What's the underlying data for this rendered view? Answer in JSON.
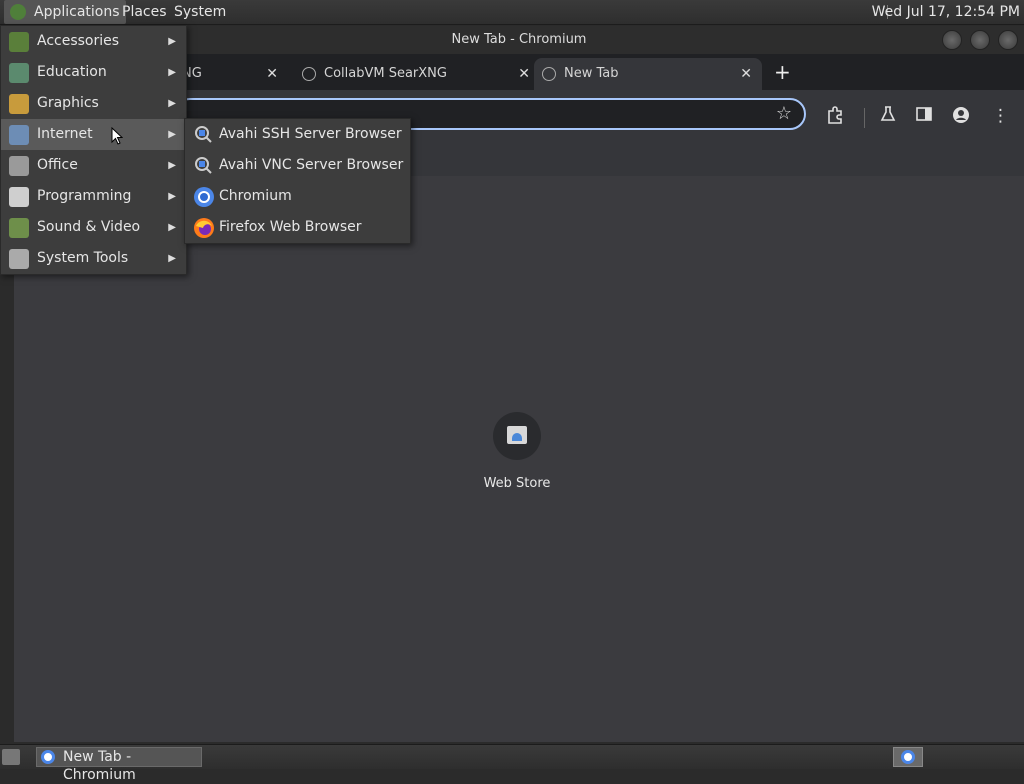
{
  "top_panel": {
    "applications": "Applications",
    "places": "Places",
    "system": "System",
    "clock": "Wed Jul 17, 12:54 PM"
  },
  "window": {
    "title": "New Tab - Chromium"
  },
  "tabs": [
    {
      "title": "NG",
      "close": "✕"
    },
    {
      "title": "CollabVM SearXNG",
      "close": "✕"
    },
    {
      "title": "New Tab",
      "close": "✕"
    }
  ],
  "new_tab": "+",
  "icons": {
    "star": "☆",
    "extensions": "puzzle-icon",
    "labs": "flask-icon",
    "side_panel": "side-panel-icon",
    "profile": "profile-icon",
    "more": "⋮"
  },
  "content": {
    "shortcut_label": "Web Store"
  },
  "apps_menu": {
    "items": [
      {
        "label": "Accessories",
        "icon": "accessories-icon",
        "color": "#5a7f3a"
      },
      {
        "label": "Education",
        "icon": "education-icon",
        "color": "#5b8a6e"
      },
      {
        "label": "Graphics",
        "icon": "graphics-icon",
        "color": "#c89b3c"
      },
      {
        "label": "Internet",
        "icon": "internet-icon",
        "color": "#6d8db5"
      },
      {
        "label": "Office",
        "icon": "office-icon",
        "color": "#9a9a9a"
      },
      {
        "label": "Programming",
        "icon": "programming-icon",
        "color": "#cfcfcf"
      },
      {
        "label": "Sound & Video",
        "icon": "sound-video-icon",
        "color": "#6e8f4a"
      },
      {
        "label": "System Tools",
        "icon": "system-tools-icon",
        "color": "#aaaaaa"
      }
    ],
    "arrow": "▶"
  },
  "internet_submenu": {
    "items": [
      {
        "label": "Avahi SSH Server Browser",
        "icon": "avahi-ssh-icon"
      },
      {
        "label": "Avahi VNC Server Browser",
        "icon": "avahi-vnc-icon"
      },
      {
        "label": "Chromium",
        "icon": "chromium-icon"
      },
      {
        "label": "Firefox Web Browser",
        "icon": "firefox-icon"
      }
    ]
  },
  "taskbar": {
    "task_label": "New Tab - Chromium"
  },
  "colors": {
    "accent": "#a8c7fa",
    "chromium_blue": "#4b86e8"
  }
}
